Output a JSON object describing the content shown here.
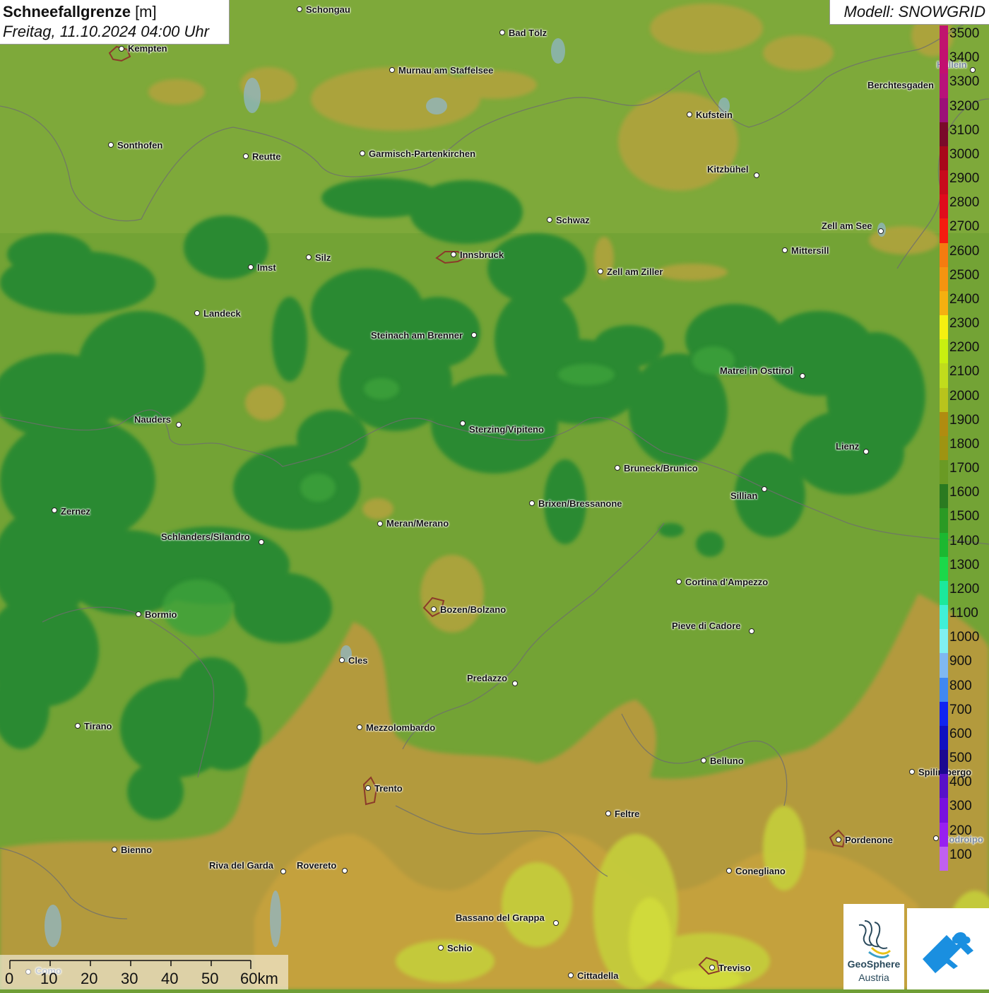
{
  "header": {
    "title_bold": "Schneefallgrenze",
    "title_unit": " [m]",
    "subtitle": "Freitag, 11.10.2024 04:00 Uhr",
    "model": "Modell: SNOWGRID"
  },
  "legend": {
    "values": [
      "3500",
      "3400",
      "3300",
      "3200",
      "3100",
      "3000",
      "2900",
      "2800",
      "2700",
      "2600",
      "2500",
      "2400",
      "2300",
      "2200",
      "2100",
      "2000",
      "1900",
      "1800",
      "1700",
      "1600",
      "1500",
      "1400",
      "1300",
      "1200",
      "1100",
      "1000",
      "900",
      "800",
      "700",
      "600",
      "500",
      "400",
      "300",
      "200",
      "100"
    ],
    "colors": [
      "#c0146e",
      "#c21070",
      "#b8127a",
      "#9c1078",
      "#7a0a2a",
      "#a8081a",
      "#c80c1c",
      "#e00c1c",
      "#f51c10",
      "#f47c10",
      "#f49410",
      "#f5b010",
      "#f5f010",
      "#c8f010",
      "#c0dc1c",
      "#b8c41c",
      "#b08c10",
      "#9e9412",
      "#6a9a24",
      "#2a7a20",
      "#2a9a24",
      "#1cb830",
      "#1cd84a",
      "#1ce89c",
      "#40f0d8",
      "#80f0f0",
      "#80b8f0",
      "#4088f0",
      "#1024f0",
      "#1010c0",
      "#1c0890",
      "#5810c8",
      "#7810e0",
      "#9820f0",
      "#c060f0"
    ]
  },
  "cities": [
    {
      "name": "Schongau"
    },
    {
      "name": "Bad Tölz"
    },
    {
      "name": "Kempten"
    },
    {
      "name": "Murnau am Staffelsee"
    },
    {
      "name": "Hallein"
    },
    {
      "name": "Berchtesgaden"
    },
    {
      "name": "Kufstein"
    },
    {
      "name": "Sonthofen"
    },
    {
      "name": "Reutte"
    },
    {
      "name": "Garmisch-Partenkirchen"
    },
    {
      "name": "Kitzbühel"
    },
    {
      "name": "Schwaz"
    },
    {
      "name": "Zell am See"
    },
    {
      "name": "Mittersill"
    },
    {
      "name": "Innsbruck"
    },
    {
      "name": "Imst"
    },
    {
      "name": "Silz"
    },
    {
      "name": "Zell am Ziller"
    },
    {
      "name": "Landeck"
    },
    {
      "name": "Steinach am Brenner"
    },
    {
      "name": "Matrei in Osttirol"
    },
    {
      "name": "Nauders"
    },
    {
      "name": "Sterzing/Vipiteno"
    },
    {
      "name": "Lienz"
    },
    {
      "name": "Bruneck/Brunico"
    },
    {
      "name": "Sillian"
    },
    {
      "name": "Zernez"
    },
    {
      "name": "Brixen/Bressanone"
    },
    {
      "name": "Meran/Merano"
    },
    {
      "name": "Schlanders/Silandro"
    },
    {
      "name": "Cortina d'Ampezzo"
    },
    {
      "name": "Bozen/Bolzano"
    },
    {
      "name": "Bormio"
    },
    {
      "name": "Pieve di Cadore"
    },
    {
      "name": "Cles"
    },
    {
      "name": "Predazzo"
    },
    {
      "name": "Tirano"
    },
    {
      "name": "Mezzolombardo"
    },
    {
      "name": "Belluno"
    },
    {
      "name": "Spilimbergo"
    },
    {
      "name": "Trento"
    },
    {
      "name": "Feltre"
    },
    {
      "name": "Pordenone"
    },
    {
      "name": "Bienno"
    },
    {
      "name": "Riva del Garda"
    },
    {
      "name": "Rovereto"
    },
    {
      "name": "Conegliano"
    },
    {
      "name": "Bassano del Grappa"
    },
    {
      "name": "Schio"
    },
    {
      "name": "Treviso"
    },
    {
      "name": "Cittadella"
    },
    {
      "name": "Como"
    },
    {
      "name": "Codroipo"
    }
  ],
  "scale": {
    "labels": [
      "0",
      "10",
      "20",
      "30",
      "40",
      "50",
      "60km"
    ]
  },
  "logo": {
    "name": "GeoSphere",
    "sub": "Austria"
  }
}
